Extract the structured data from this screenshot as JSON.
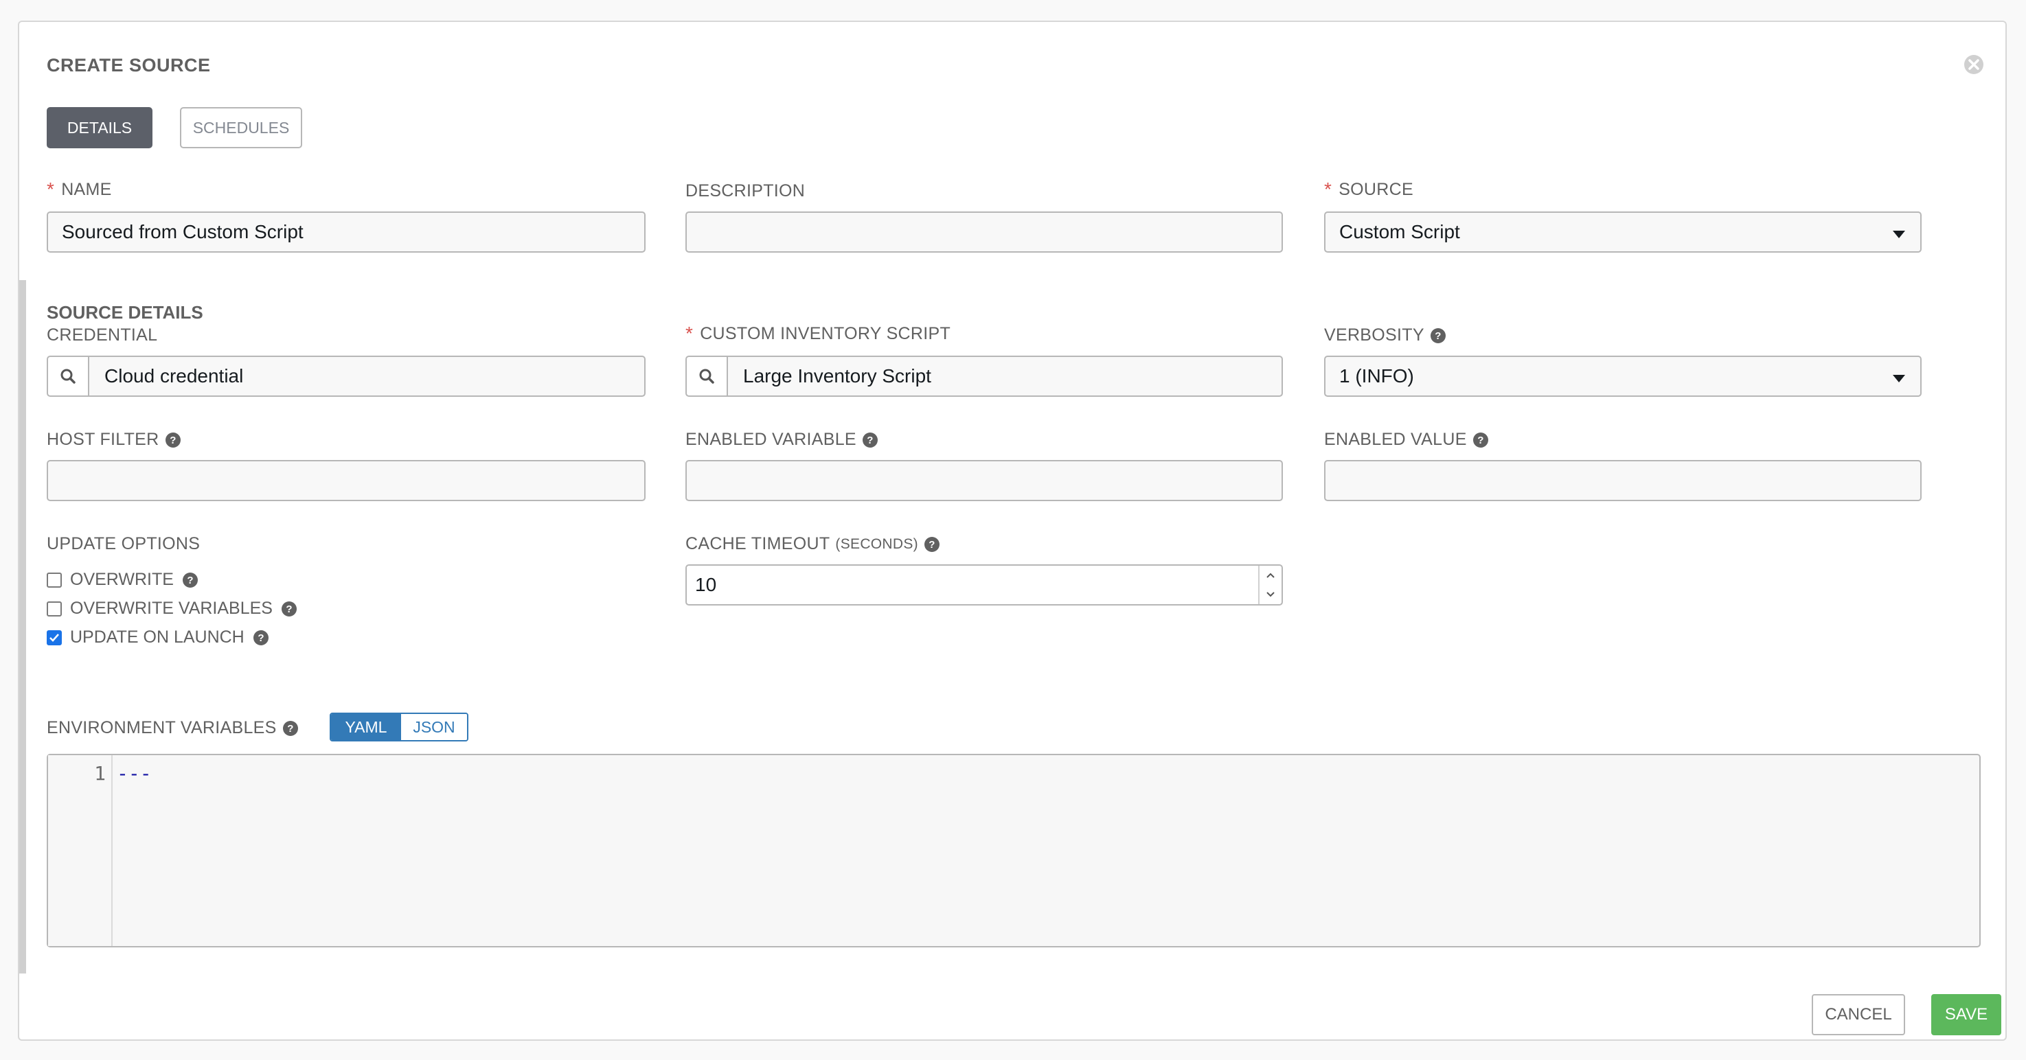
{
  "dialog": {
    "title": "CREATE SOURCE",
    "tabs": [
      {
        "label": "DETAILS",
        "active": true
      },
      {
        "label": "SCHEDULES",
        "active": false
      }
    ]
  },
  "fields": {
    "name": {
      "label": "NAME",
      "required": true,
      "value": "Sourced from Custom Script"
    },
    "description": {
      "label": "DESCRIPTION",
      "value": ""
    },
    "source": {
      "label": "SOURCE",
      "required": true,
      "value": "Custom Script"
    }
  },
  "source_details": {
    "title": "SOURCE DETAILS",
    "credential": {
      "label": "CREDENTIAL",
      "value": "Cloud credential"
    },
    "custom_inventory_script": {
      "label": "CUSTOM INVENTORY SCRIPT",
      "required": true,
      "value": "Large Inventory Script"
    },
    "verbosity": {
      "label": "VERBOSITY",
      "value": "1 (INFO)"
    },
    "host_filter": {
      "label": "HOST FILTER",
      "value": ""
    },
    "enabled_variable": {
      "label": "ENABLED VARIABLE",
      "value": ""
    },
    "enabled_value": {
      "label": "ENABLED VALUE",
      "value": ""
    },
    "update_options": {
      "label": "UPDATE OPTIONS",
      "options": [
        {
          "label": "OVERWRITE",
          "checked": false
        },
        {
          "label": "OVERWRITE VARIABLES",
          "checked": false
        },
        {
          "label": "UPDATE ON LAUNCH",
          "checked": true
        }
      ]
    },
    "cache_timeout": {
      "label": "CACHE TIMEOUT",
      "label_unit": "(SECONDS)",
      "value": "10"
    },
    "environment_variables": {
      "label": "ENVIRONMENT VARIABLES",
      "formats": [
        "YAML",
        "JSON"
      ],
      "active_format": "YAML",
      "line_number": "1",
      "content": "---"
    }
  },
  "actions": {
    "cancel": "CANCEL",
    "save": "SAVE"
  },
  "colors": {
    "save": "#5cb85c",
    "tab_active": "#5c6069",
    "toggle_active": "#337ab7",
    "required": "#d9534f"
  },
  "icons": {
    "close": "close-circle-icon",
    "help": "question-circle-icon",
    "search": "search-icon",
    "dropdown": "caret-down-icon"
  }
}
